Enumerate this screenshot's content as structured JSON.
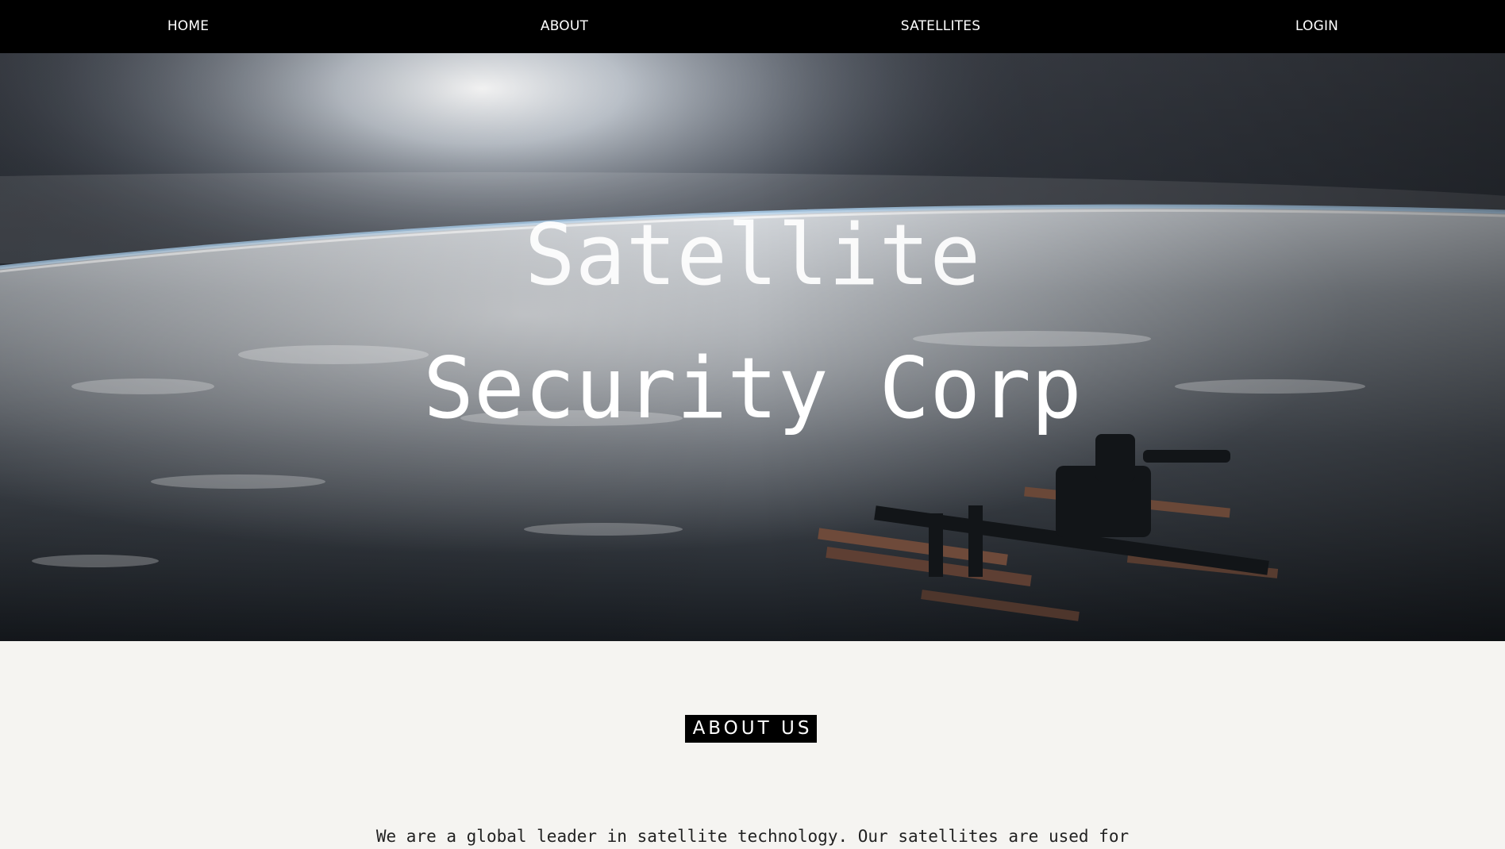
{
  "nav": {
    "items": [
      {
        "label": "HOME"
      },
      {
        "label": "ABOUT"
      },
      {
        "label": "SATELLITES"
      },
      {
        "label": "LOGIN"
      }
    ]
  },
  "hero": {
    "title_line1": "Satellite",
    "title_line2": "Security Corp",
    "image": "earth-orbit-space-station"
  },
  "about": {
    "heading": "ABOUT US",
    "text": "We are a global leader in satellite technology. Our satellites are used for"
  },
  "colors": {
    "nav_bg": "#000000",
    "nav_text": "#ffffff",
    "page_bg": "#f5f4f1",
    "badge_bg": "#000000",
    "body_text": "#222222"
  }
}
